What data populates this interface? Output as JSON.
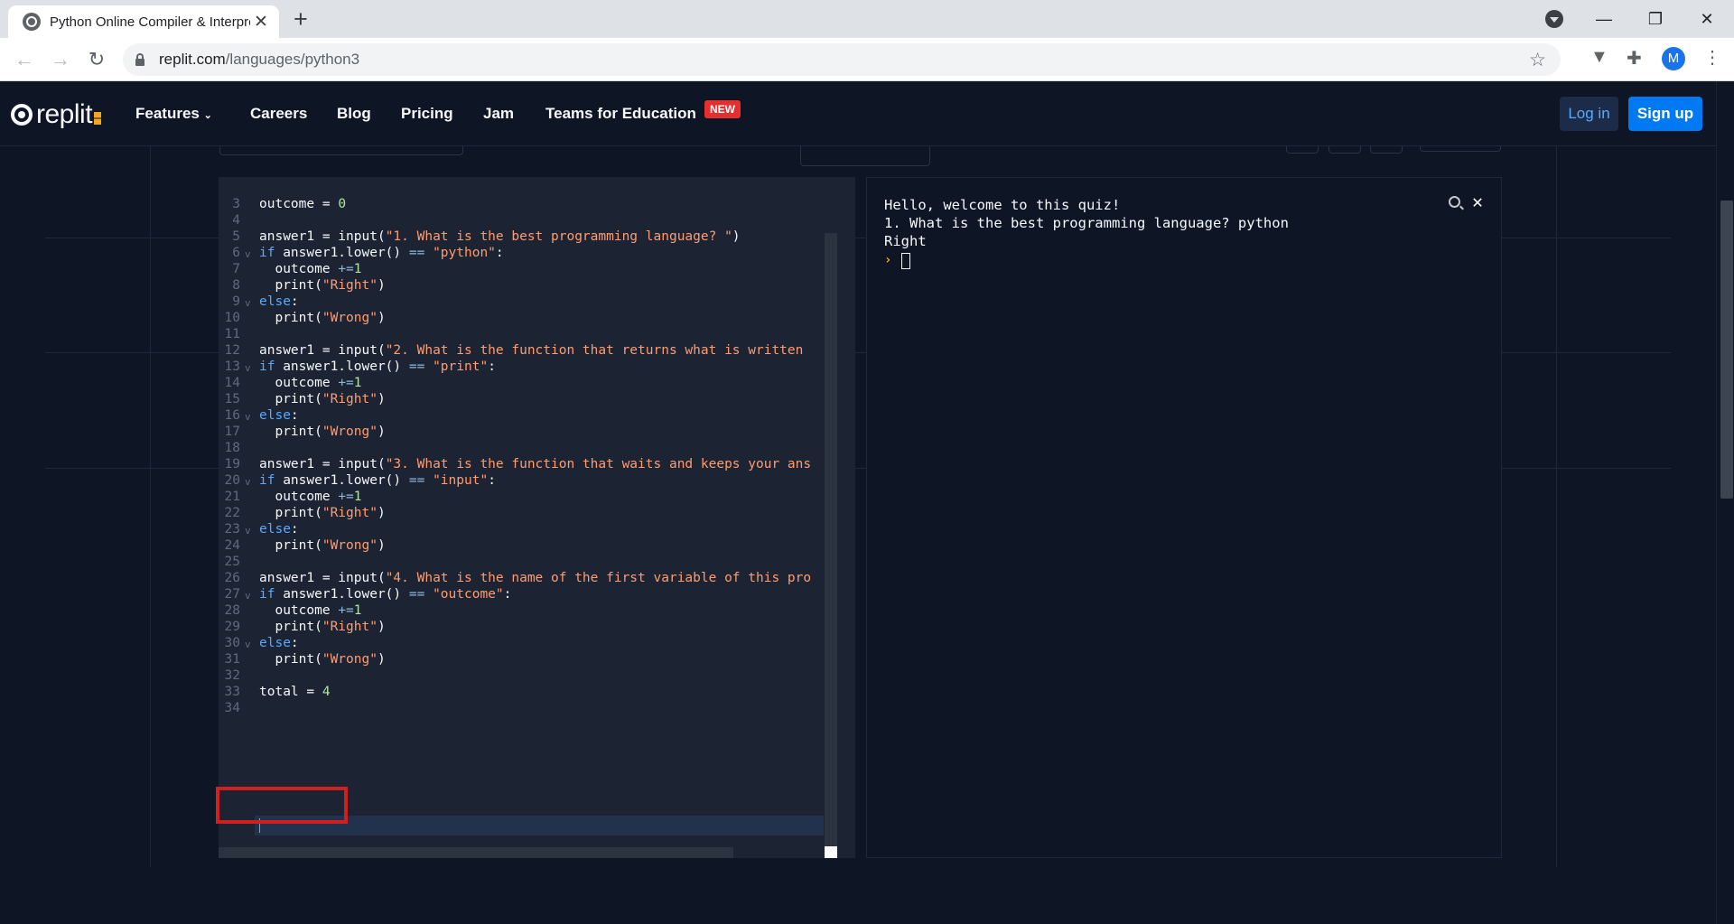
{
  "browser": {
    "tab_title": "Python Online Compiler & Interpreter",
    "tab_close": "✕",
    "new_tab": "+",
    "url_domain": "replit.com",
    "url_path": "/languages/python3",
    "avatar_letter": "M",
    "window_minimize": "—",
    "window_restore": "❐",
    "window_close": "✕"
  },
  "site": {
    "logo_text": "replit",
    "nav": {
      "features": "Features",
      "careers": "Careers",
      "blog": "Blog",
      "pricing": "Pricing",
      "jam": "Jam",
      "teams": "Teams for Education",
      "new_badge": "NEW"
    },
    "login": "Log in",
    "signup": "Sign up"
  },
  "editor": {
    "lines": [
      {
        "n": "3",
        "fold": "",
        "code": "outcome = 0"
      },
      {
        "n": "4",
        "fold": "",
        "code": ""
      },
      {
        "n": "5",
        "fold": "",
        "code": "answer1 = input(\"1. What is the best programming language? \")"
      },
      {
        "n": "6",
        "fold": "v",
        "code": "if answer1.lower() == \"python\":"
      },
      {
        "n": "7",
        "fold": "",
        "code": "  outcome +=1"
      },
      {
        "n": "8",
        "fold": "",
        "code": "  print(\"Right\")"
      },
      {
        "n": "9",
        "fold": "v",
        "code": "else:"
      },
      {
        "n": "10",
        "fold": "",
        "code": "  print(\"Wrong\")"
      },
      {
        "n": "11",
        "fold": "",
        "code": ""
      },
      {
        "n": "12",
        "fold": "",
        "code": "answer1 = input(\"2. What is the function that returns what is written"
      },
      {
        "n": "13",
        "fold": "v",
        "code": "if answer1.lower() == \"print\":"
      },
      {
        "n": "14",
        "fold": "",
        "code": "  outcome +=1"
      },
      {
        "n": "15",
        "fold": "",
        "code": "  print(\"Right\")"
      },
      {
        "n": "16",
        "fold": "v",
        "code": "else:"
      },
      {
        "n": "17",
        "fold": "",
        "code": "  print(\"Wrong\")"
      },
      {
        "n": "18",
        "fold": "",
        "code": ""
      },
      {
        "n": "19",
        "fold": "",
        "code": "answer1 = input(\"3. What is the function that waits and keeps your ans"
      },
      {
        "n": "20",
        "fold": "v",
        "code": "if answer1.lower() == \"input\":"
      },
      {
        "n": "21",
        "fold": "",
        "code": "  outcome +=1"
      },
      {
        "n": "22",
        "fold": "",
        "code": "  print(\"Right\")"
      },
      {
        "n": "23",
        "fold": "v",
        "code": "else:"
      },
      {
        "n": "24",
        "fold": "",
        "code": "  print(\"Wrong\")"
      },
      {
        "n": "25",
        "fold": "",
        "code": ""
      },
      {
        "n": "26",
        "fold": "",
        "code": "answer1 = input(\"4. What is the name of the first variable of this pro"
      },
      {
        "n": "27",
        "fold": "v",
        "code": "if answer1.lower() == \"outcome\":"
      },
      {
        "n": "28",
        "fold": "",
        "code": "  outcome +=1"
      },
      {
        "n": "29",
        "fold": "",
        "code": "  print(\"Right\")"
      },
      {
        "n": "30",
        "fold": "v",
        "code": "else:"
      },
      {
        "n": "31",
        "fold": "",
        "code": "  print(\"Wrong\")"
      },
      {
        "n": "32",
        "fold": "",
        "code": ""
      },
      {
        "n": "33",
        "fold": "",
        "code": "total = 4"
      },
      {
        "n": "34",
        "fold": "",
        "code": ""
      }
    ]
  },
  "console": {
    "lines": [
      "Hello, welcome to this quiz!",
      "1. What is the best programming language? python",
      "Right"
    ],
    "prompt": "›"
  },
  "colors": {
    "page_bg": "#0e1525",
    "editor_bg": "#1c2333",
    "keyword": "#57abff",
    "string": "#ff9c70",
    "number": "#b5e5a3",
    "highlight_box": "#d01f1f",
    "signup_bg": "#0079f2"
  }
}
